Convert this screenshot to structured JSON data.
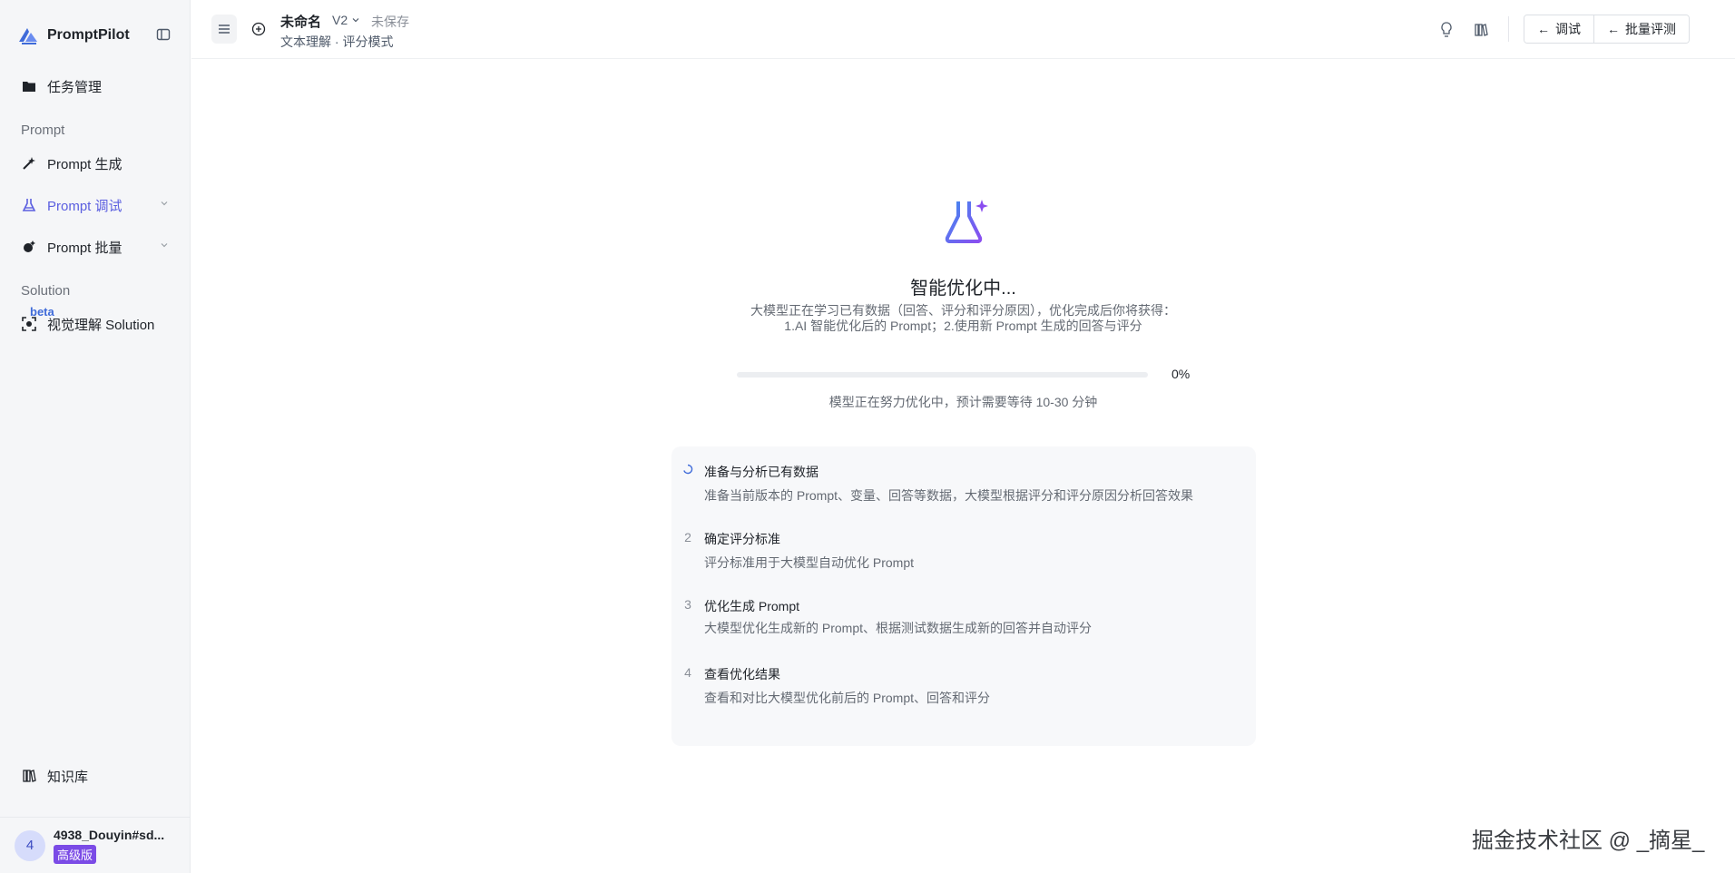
{
  "sidebar": {
    "brand": "PromptPilot",
    "items": {
      "tasks": "任务管理",
      "prompt_section": "Prompt",
      "prompt_gen": "Prompt 生成",
      "prompt_debug": "Prompt 调试",
      "prompt_batch": "Prompt 批量",
      "solution_section": "Solution",
      "beta": "beta",
      "visual_solution": "视觉理解 Solution",
      "knowledge": "知识库"
    },
    "user": {
      "avatar_initial": "4",
      "name": "4938_Douyin#sd...",
      "plan": "高级版"
    }
  },
  "header": {
    "title": "未命名",
    "version": "V2",
    "status": "未保存",
    "subtitle": "文本理解 · 评分模式",
    "buttons": {
      "debug": "调试",
      "batch_eval": "批量评测"
    }
  },
  "main": {
    "title": "智能优化中...",
    "desc_line1": "大模型正在学习已有数据（回答、评分和评分原因），优化完成后你将获得：",
    "desc_line2": "1.AI 智能优化后的 Prompt；2.使用新 Prompt 生成的回答与评分",
    "progress": 0,
    "progress_label": "0%",
    "progress_note": "模型正在努力优化中，预计需要等待 10-30 分钟",
    "steps": [
      {
        "num": "",
        "title": "准备与分析已有数据",
        "desc": "准备当前版本的 Prompt、变量、回答等数据，大模型根据评分和评分原因分析回答效果"
      },
      {
        "num": "2",
        "title": "确定评分标准",
        "desc": "评分标准用于大模型自动优化 Prompt"
      },
      {
        "num": "3",
        "title": "优化生成 Prompt",
        "desc": "大模型优化生成新的 Prompt、根据测试数据生成新的回答并自动评分"
      },
      {
        "num": "4",
        "title": "查看优化结果",
        "desc": "查看和对比大模型优化前后的 Prompt、回答和评分"
      }
    ]
  },
  "watermark": "掘金技术社区 @ _摘星_",
  "colors": {
    "accent": "#5b5fe0",
    "sidebar_bg": "#f5f6f8",
    "plan_badge": "#7b4be6"
  }
}
